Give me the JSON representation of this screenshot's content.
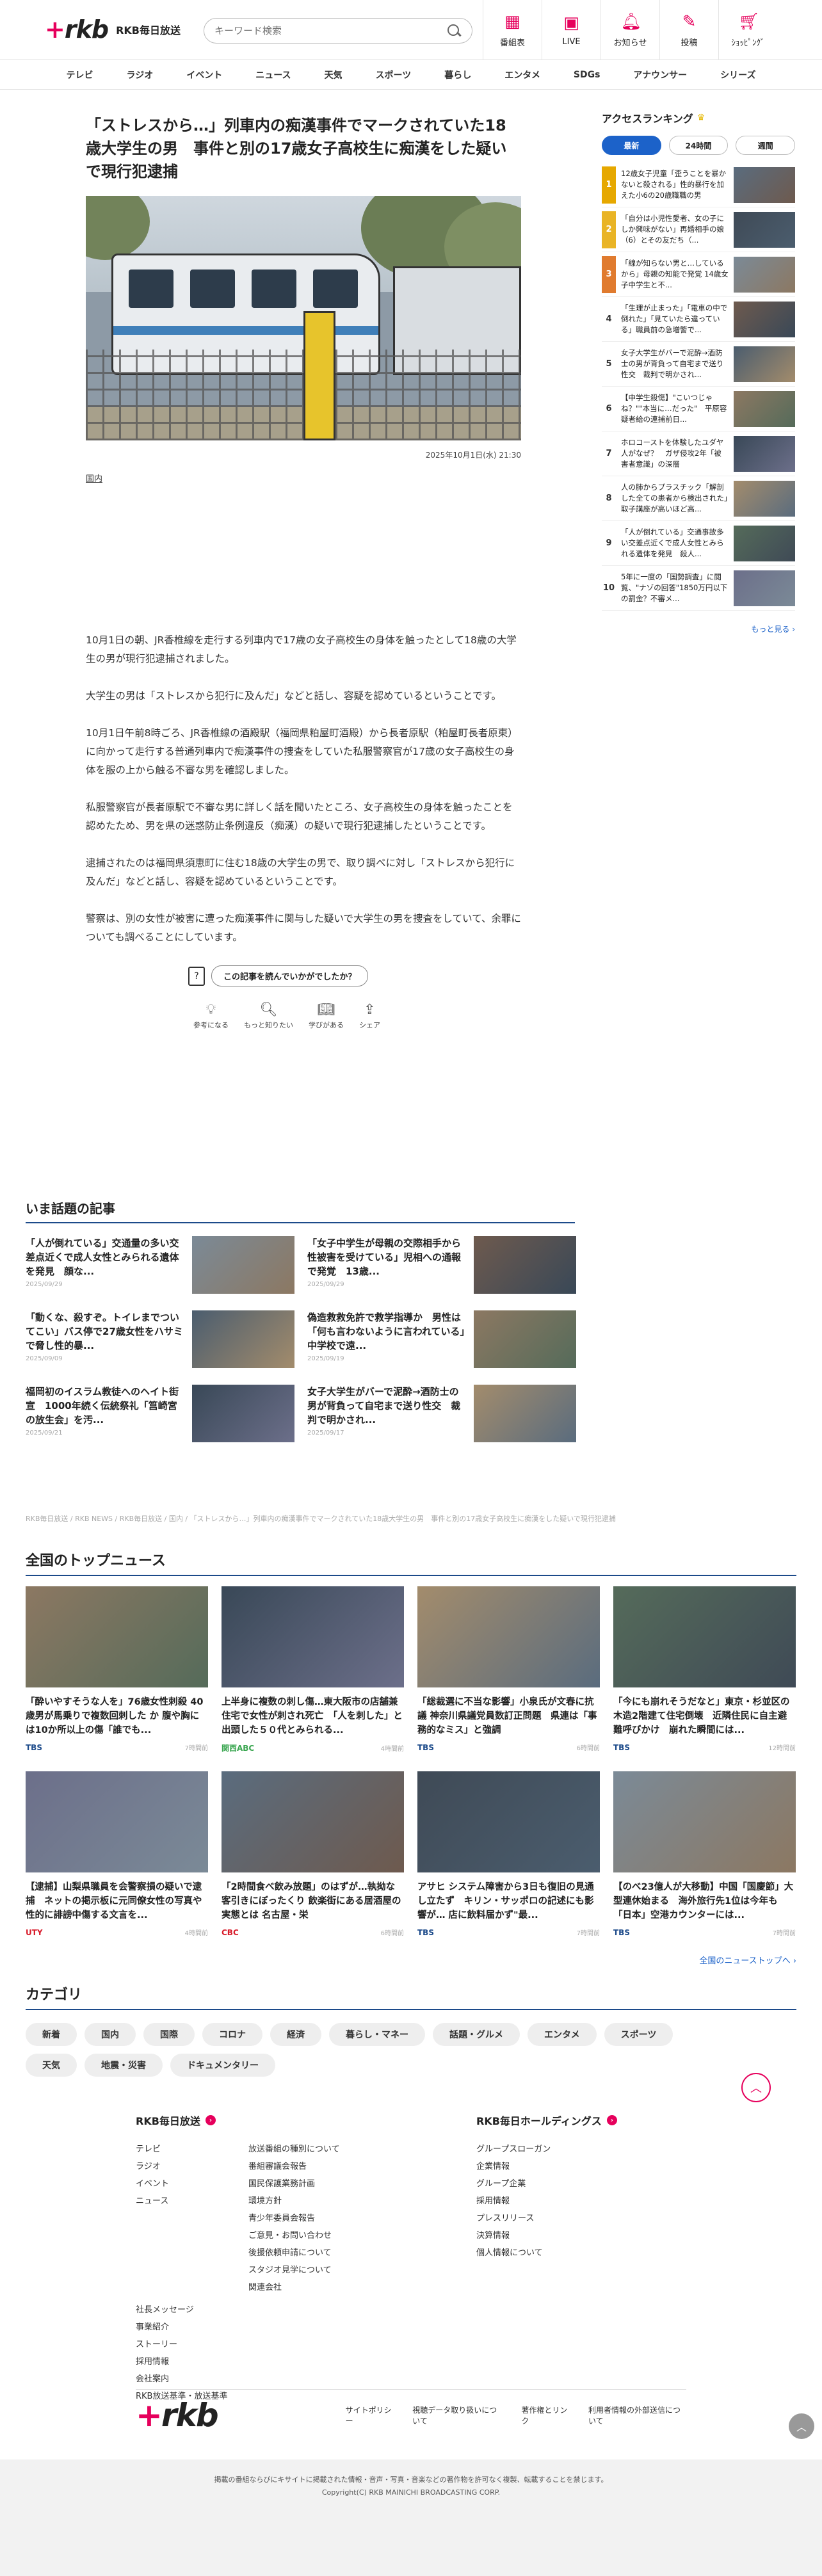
{
  "header": {
    "logo": "rkb",
    "brand": "RKB毎日放送",
    "search_placeholder": "キーワード検索",
    "nav": [
      {
        "label": "番組表",
        "icon": "calendar-icon"
      },
      {
        "label": "LIVE",
        "icon": "live-icon"
      },
      {
        "label": "お知らせ",
        "icon": "bell-icon"
      },
      {
        "label": "投稿",
        "icon": "post-icon"
      },
      {
        "label": "ｼｮｯﾋﾟﾝｸﾞ",
        "icon": "cart-icon"
      }
    ]
  },
  "global_nav": [
    "テレビ",
    "ラジオ",
    "イベント",
    "ニュース",
    "天気",
    "スポーツ",
    "暮らし",
    "エンタメ",
    "SDGs",
    "アナウンサー",
    "シリーズ"
  ],
  "article": {
    "title": "「ストレスから…」列車内の痴漢事件でマークされていた18歳大学生の男　事件と別の17歳女子高校生に痴漢をした疑いで現行犯逮捕",
    "date": "2025年10月1日(水) 21:30",
    "category": "国内",
    "body": [
      "10月1日の朝、JR香椎線を走行する列車内で17歳の女子高校生の身体を触ったとして18歳の大学生の男が現行犯逮捕されました。",
      "大学生の男は「ストレスから犯行に及んだ」などと話し、容疑を認めているということです。",
      "10月1日午前8時ごろ、JR香椎線の酒殿駅（福岡県粕屋町酒殿）から長者原駅（粕屋町長者原東）に向かって走行する普通列車内で痴漢事件の捜査をしていた私服警察官が17歳の女子高校生の身体を服の上から触る不審な男を確認しました。",
      "私服警察官が長者原駅で不審な男に詳しく話を聞いたところ、女子高校生の身体を触ったことを認めたため、男を県の迷惑防止条例違反（痴漢）の疑いで現行犯逮捕したということです。",
      "逮捕されたのは福岡県須恵町に住む18歳の大学生の男で、取り調べに対し「ストレスから犯行に及んだ」などと話し、容疑を認めているということです。",
      "警察は、別の女性が被害に遭った痴漢事件に関与した疑いで大学生の男を捜査をしていて、余罪についても調べることにしています。"
    ],
    "ask_label": "この記事を読んでいかがでしたか？",
    "reactions": [
      {
        "label": "参考になる",
        "icon": "bulb-icon"
      },
      {
        "label": "もっと知りたい",
        "icon": "search-icon"
      },
      {
        "label": "学びがある",
        "icon": "book-icon"
      },
      {
        "label": "シェア",
        "icon": "share-icon"
      }
    ]
  },
  "ranking": {
    "title": "アクセスランキング",
    "tabs": [
      "最新",
      "24時間",
      "週間"
    ],
    "items": [
      {
        "num": "1",
        "text": "12歳女子児童「歪うことを暴かないと殺される」性的暴行を加えた小6の20歳職職の男"
      },
      {
        "num": "2",
        "text": "「自分は小児性愛者、女の子にしか興味がない」再婚相手の娘（6）とその友だち（..."
      },
      {
        "num": "3",
        "text": "「線が知らない男と…しているから」母親の知能で発覚 14歳女子中学生と不..."
      },
      {
        "num": "4",
        "text": "「生理が止まった」「電車の中で倒れた」「見ていたら違っている」職員前の急増警で..."
      },
      {
        "num": "5",
        "text": "女子大学生がバーで泥酔→酒防士の男が背負って自宅まで送り性交　裁判で明かされ..."
      },
      {
        "num": "6",
        "text": "【中学生殺傷】\"こいつじゃね？\"\"本当に…だった\"　平原容疑者給の連捕前日..."
      },
      {
        "num": "7",
        "text": "ホロコーストを体験したユダヤ人がなぜ？　ガザ侵攻2年「被害者意識」の深層"
      },
      {
        "num": "8",
        "text": "人の肺からプラスチック「解剖した全ての患者から検出された」取子講座が高いほど高..."
      },
      {
        "num": "9",
        "text": "「人が倒れている」交通事故多い交差点近くで成人女性とみられる遺体を発見　殺人..."
      },
      {
        "num": "10",
        "text": "5年に一度の「国勢調査」に閲覧、\"ナゾの回答\"1850万円以下の罰金？不審メ..."
      }
    ],
    "more": "もっと見る ›"
  },
  "popular": {
    "title": "いま話題の記事",
    "items": [
      {
        "title": "「人が倒れている」交通量の多い交差点近くで成人女性とみられる遺体を発見　顔な...",
        "date": "2025/09/29"
      },
      {
        "title": "「女子中学生が母親の交際相手から性被害を受けている」児相への通報で発覚　13歳...",
        "date": "2025/09/29"
      },
      {
        "title": "「動くな、殺すぞ。トイレまでついてこい」バス停で27歳女性をハサミで脅し性的暴...",
        "date": "2025/09/09"
      },
      {
        "title": "偽造救救免許で救学指導か　男性は「何も言わないように言われている」中学校で遠...",
        "date": "2025/09/19"
      },
      {
        "title": "福岡初のイスラム教徒へのヘイト街宣　1000年続く伝統祭礼「筥崎宮の放生会」を汚...",
        "date": "2025/09/21"
      },
      {
        "title": "女子大学生がバーで泥酔→酒防士の男が背負って自宅まで送り性交　裁判で明かされ...",
        "date": "2025/09/17"
      }
    ]
  },
  "breadcrumb": "RKB毎日放送 / RKB NEWS / RKB毎日放送 / 国内 / 「ストレスから…」列車内の痴漢事件でマークされていた18歳大学生の男　事件と別の17歳女子高校生に痴漢をした疑いで現行犯逮捕",
  "national": {
    "title": "全国のトップニュース",
    "items": [
      {
        "title": "「酔いやすそうな人を」76歳女性刺殺 40歳男が馬乗りで複数回刺した か 腹や胸には10か所以上の傷「誰でも...",
        "src": "TBS",
        "src_class": "",
        "time": "7時間前"
      },
      {
        "title": "上半身に複数の刺し傷…東大阪市の店舗兼住宅で女性が刺され死亡　「人を刺した」と出頭した５０代とみられる...",
        "src": "関西ABC",
        "src_class": "dome",
        "time": "4時間前"
      },
      {
        "title": "「総裁選に不当な影響」小泉氏が文春に抗議 神奈川県議党員数訂正問題　県連は「事務的なミス」と強調",
        "src": "TBS",
        "src_class": "",
        "time": "6時間前"
      },
      {
        "title": "「今にも崩れそうだなと」東京・杉並区の木造2階建て住宅倒壊　近隣住民に自主避難呼びかけ　崩れた瞬間には...",
        "src": "TBS",
        "src_class": "",
        "time": "12時間前"
      },
      {
        "title": "【逮捕】山梨県職員を会警察損の疑いで逮捕　ネットの掲示板に元同僚女性の写真や性的に誹謗中傷する文言を...",
        "src": "UTY",
        "src_class": "utv",
        "time": "4時間前"
      },
      {
        "title": "「2時間食べ飲み放題」のはずが…執拗な客引きにぼったくり 飲楽街にある居酒屋の実態とは 名古屋・栄",
        "src": "CBC",
        "src_class": "rcc",
        "time": "6時間前"
      },
      {
        "title": "アサヒ システム障害から3日も復旧の見通し立たず　キリン・サッポロの記述にも影響が… 店に飲料届かず\"最...",
        "src": "TBS",
        "src_class": "",
        "time": "7時間前"
      },
      {
        "title": "【のべ23億人が大移動】中国「国慶節」大型連休始まる　海外旅行先1位は今年も「日本」空港カウンターには...",
        "src": "TBS",
        "src_class": "",
        "time": "7時間前"
      }
    ],
    "more": "全国のニューストップへ ›"
  },
  "categories": {
    "title": "カテゴリ",
    "chips": [
      "新着",
      "国内",
      "国際",
      "コロナ",
      "経済",
      "暮らし・マネー",
      "話題・グルメ",
      "エンタメ",
      "スポーツ",
      "天気",
      "地震・災害",
      "ドキュメンタリー"
    ]
  },
  "footer": {
    "col1_title": "RKB毎日放送",
    "col1a": [
      "テレビ",
      "ラジオ",
      "イベント",
      "ニュース"
    ],
    "col1b": [
      "放送番組の種別について",
      "番組審議会報告",
      "国民保護業務計画",
      "環境方針",
      "青少年委員会報告",
      "ご意見・お問い合わせ",
      "後援依頼申請について",
      "スタジオ見学について",
      "関連会社"
    ],
    "col1c": [
      "社長メッセージ",
      "事業紹介",
      "ストーリー",
      "採用情報",
      "会社案内",
      "RKB放送基準・放送基準"
    ],
    "col2_title": "RKB毎日ホールディングス",
    "col2": [
      "グループスローガン",
      "企業情報",
      "グループ企業",
      "採用情報",
      "プレスリリース",
      "決算情報",
      "個人情報について"
    ],
    "logo": "rkb",
    "bottom_links": [
      "サイトポリシー",
      "視聴データ取り扱いについて",
      "著作権とリンク",
      "利用者情報の外部送信について"
    ],
    "notice": "掲載の番組ならびにキサイトに掲載された情報・音声・写真・音楽などの著作物を許可なく複製、転載することを禁じます。",
    "copyright": "Copyright(C) RKB MAINICHI BROADCASTING CORP."
  }
}
